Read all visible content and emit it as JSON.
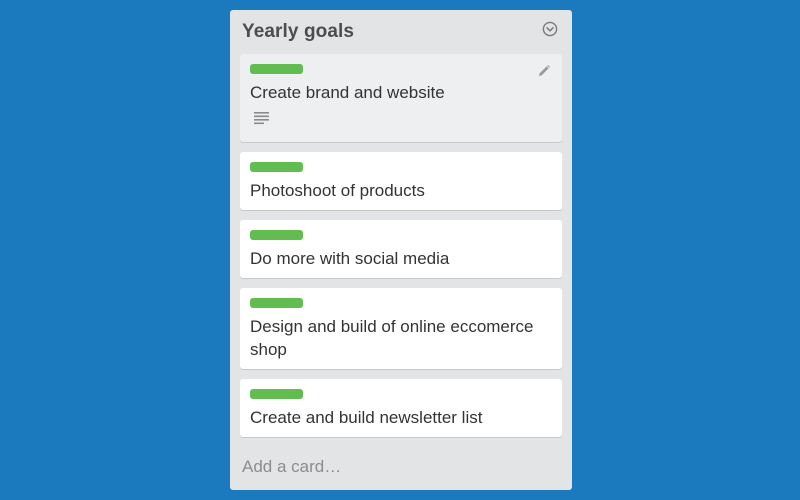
{
  "list": {
    "title": "Yearly goals",
    "menu_icon": "chevron-circle-down-icon",
    "label_color": "#61BD4F",
    "cards": [
      {
        "title": "Create brand and website",
        "label_color": "green",
        "has_description": true,
        "icon_edit": "pencil-icon",
        "icon_description": "description-lines-icon"
      },
      {
        "title": "Photoshoot of products",
        "label_color": "green"
      },
      {
        "title": "Do more with social media",
        "label_color": "green"
      },
      {
        "title": "Design and build of online eccomerce shop",
        "label_color": "green"
      },
      {
        "title": "Create and build newsletter list",
        "label_color": "green"
      }
    ],
    "add_card_label": "Add a card…"
  },
  "colors": {
    "board_background": "#1B79BD",
    "list_background": "#E2E4E6",
    "card_background": "#FFFFFF",
    "active_card_background": "#EDEFF0",
    "text": "#333333"
  }
}
